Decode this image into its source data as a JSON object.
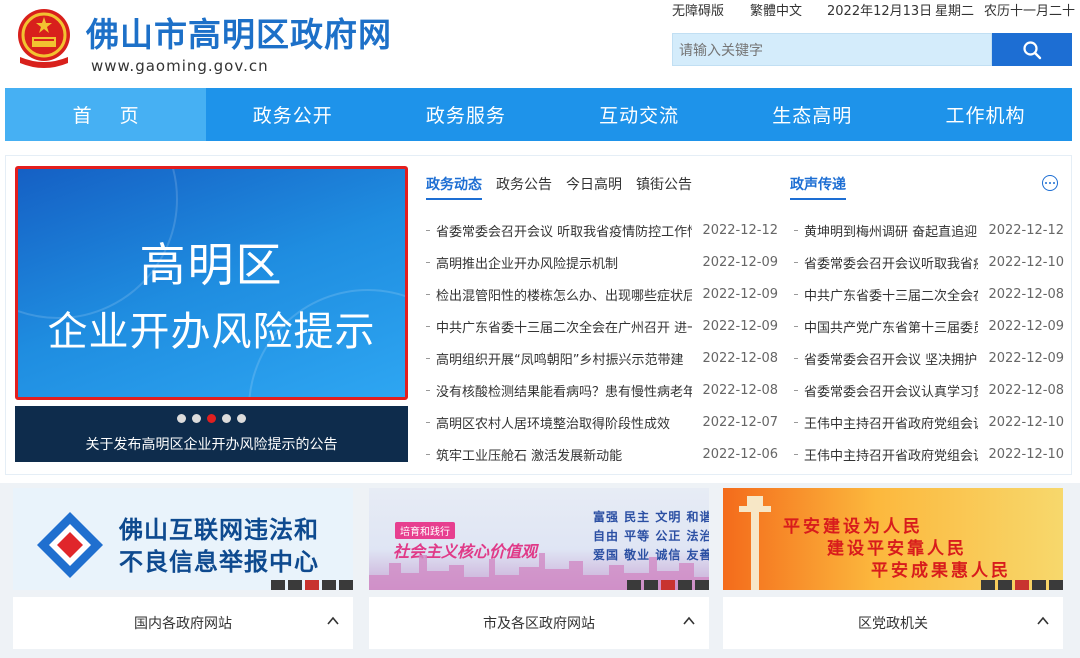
{
  "header": {
    "site_title": "佛山市高明区政府网",
    "site_url": "www.gaoming.gov.cn",
    "accessibility": "无障碍版",
    "traditional": "繁體中文",
    "date": "2022年12月13日",
    "weekday": "星期二",
    "lunar": "农历十一月二十",
    "search_placeholder": "请输入关键字"
  },
  "nav": [
    "首页",
    "政务公开",
    "政务服务",
    "互动交流",
    "生态高明",
    "工作机构"
  ],
  "slider": {
    "line1": "高明区",
    "line2": "企业开办风险提示",
    "caption": "关于发布高明区企业开办风险提示的公告",
    "dots_total": 5,
    "active_dot": 2
  },
  "tabs_left": [
    "政务动态",
    "政务公告",
    "今日高明",
    "镇街公告"
  ],
  "tabs_right": [
    "政声传递"
  ],
  "news_left": [
    {
      "title": "省委常委会召开会议 听取我省疫情防控工作情",
      "date": "2022-12-12"
    },
    {
      "title": "高明推出企业开办风险提示机制",
      "date": "2022-12-09"
    },
    {
      "title": "检出混管阳性的楼栋怎么办、出现哪些症状后",
      "date": "2022-12-09"
    },
    {
      "title": "中共广东省委十三届二次全会在广州召开 进一",
      "date": "2022-12-09"
    },
    {
      "title": "高明组织开展“凤鸣朝阳”乡村振兴示范带建",
      "date": "2022-12-08"
    },
    {
      "title": "没有核酸检测结果能看病吗？患有慢性病老年",
      "date": "2022-12-08"
    },
    {
      "title": "高明区农村人居环境整治取得阶段性成效",
      "date": "2022-12-07"
    },
    {
      "title": "筑牢工业压舱石 激活发展新动能",
      "date": "2022-12-06"
    }
  ],
  "news_right": [
    {
      "title": "黄坤明到梅州调研 奋起直追迎",
      "date": "2022-12-12"
    },
    {
      "title": "省委常委会召开会议听取我省疫",
      "date": "2022-12-10"
    },
    {
      "title": "中共广东省委十三届二次全会在",
      "date": "2022-12-08"
    },
    {
      "title": "中国共产党广东省第十三届委员",
      "date": "2022-12-09"
    },
    {
      "title": "省委常委会召开会议 坚决拥护",
      "date": "2022-12-09"
    },
    {
      "title": "省委常委会召开会议认真学习贯",
      "date": "2022-12-08"
    },
    {
      "title": "王伟中主持召开省政府党组会议",
      "date": "2022-12-10"
    },
    {
      "title": "王伟中主持召开省政府党组会议",
      "date": "2022-12-10"
    }
  ],
  "banners": {
    "b1": {
      "line1": "佛山互联网违法和",
      "line2": "不良信息举报中心"
    },
    "b2": {
      "tag": "培育和践行",
      "title": "社会主义核心价值观",
      "v1": "富强 民主 文明 和谐",
      "v2": "自由 平等 公正 法治",
      "v3": "爱国 敬业 诚信 友善"
    },
    "b3": {
      "l1": "平安建设为人民",
      "l2": "建设平安靠人民",
      "l3": "平安成果惠人民"
    }
  },
  "dropdowns": [
    "国内各政府网站",
    "市及各区政府网站",
    "区党政机关"
  ],
  "colors": {
    "brand_blue": "#1d70c8",
    "nav_blue": "#1e93ea",
    "highlight_red": "#e31e1e"
  }
}
